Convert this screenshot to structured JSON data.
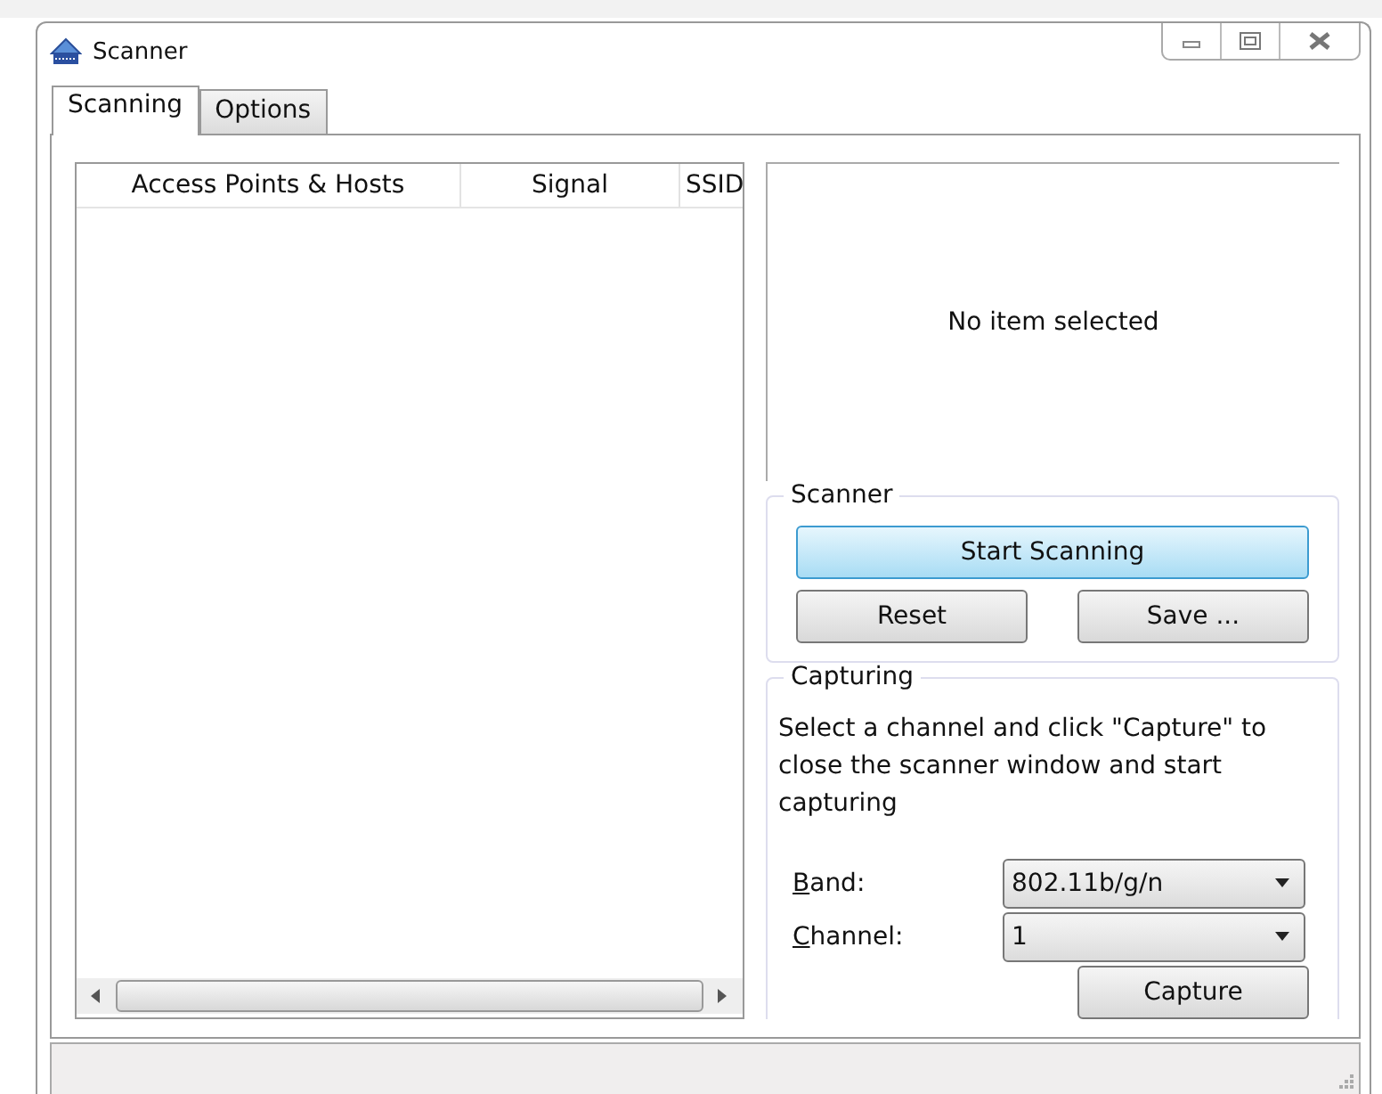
{
  "window": {
    "title": "Scanner"
  },
  "tabs": [
    {
      "label": "Scanning",
      "selected": true
    },
    {
      "label": "Options",
      "selected": false
    }
  ],
  "table": {
    "columns": [
      "Access Points & Hosts",
      "Signal",
      "SSID"
    ]
  },
  "details": {
    "text": "No item selected"
  },
  "scanner": {
    "title": "Scanner",
    "buttons": [
      {
        "label": "Start Scanning",
        "kind": "primary"
      },
      {
        "label": "Reset",
        "kind": "normal"
      },
      {
        "label": "Save ...",
        "kind": "normal"
      }
    ]
  },
  "capturing": {
    "title": "Capturing",
    "hint": "Select a channel and click \"Capture\" to close the scanner window and start capturing",
    "fields": [
      {
        "label": "Band:",
        "value": "802.11b/g/n"
      },
      {
        "label": "Channel:",
        "value": "1"
      }
    ],
    "button": "Capture"
  }
}
